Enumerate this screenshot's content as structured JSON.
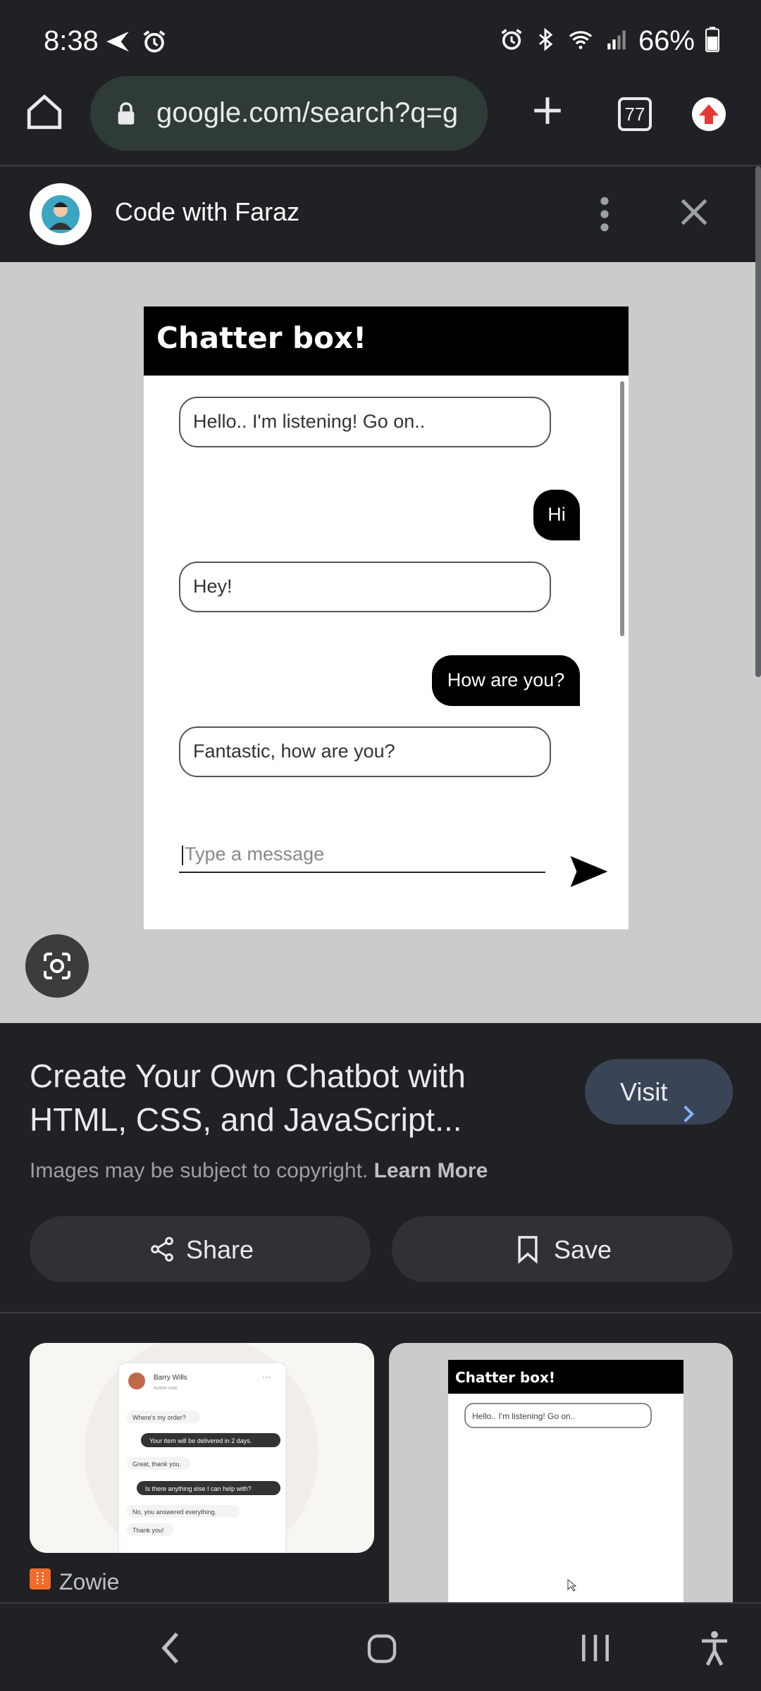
{
  "status_bar": {
    "time": "8:38",
    "battery": "66%"
  },
  "browser": {
    "url": "google.com/search?q=g",
    "tab_count": "77"
  },
  "panel": {
    "site_name": "Code with Faraz"
  },
  "chat": {
    "title": "Chatter box!",
    "messages": [
      {
        "from": "bot",
        "text": "Hello.. I'm listening! Go on.."
      },
      {
        "from": "user",
        "text": "Hi"
      },
      {
        "from": "bot",
        "text": "Hey!"
      },
      {
        "from": "user",
        "text": "How are you?"
      },
      {
        "from": "bot",
        "text": "Fantastic, how are you?"
      }
    ],
    "input_placeholder": "Type a message"
  },
  "result": {
    "title": "Create Your Own Chatbot with HTML, CSS, and JavaScript...",
    "visit_label": "Visit",
    "copyright_text": "Images may be subject to copyright.",
    "learn_more": "Learn More",
    "share_label": "Share",
    "save_label": "Save"
  },
  "related": {
    "thumb1": {
      "name": "Barry Wills",
      "status": "Active now",
      "messages": [
        "Where's my order?",
        "Your item will be delivered in 2 days.",
        "Great, thank you.",
        "Is there anything else I can help with?",
        "No, you answered everything.",
        "Thank you!"
      ],
      "source": "Zowie"
    },
    "thumb2": {
      "title": "Chatter box!",
      "first_message": "Hello.. I'm listening! Go on.."
    }
  }
}
